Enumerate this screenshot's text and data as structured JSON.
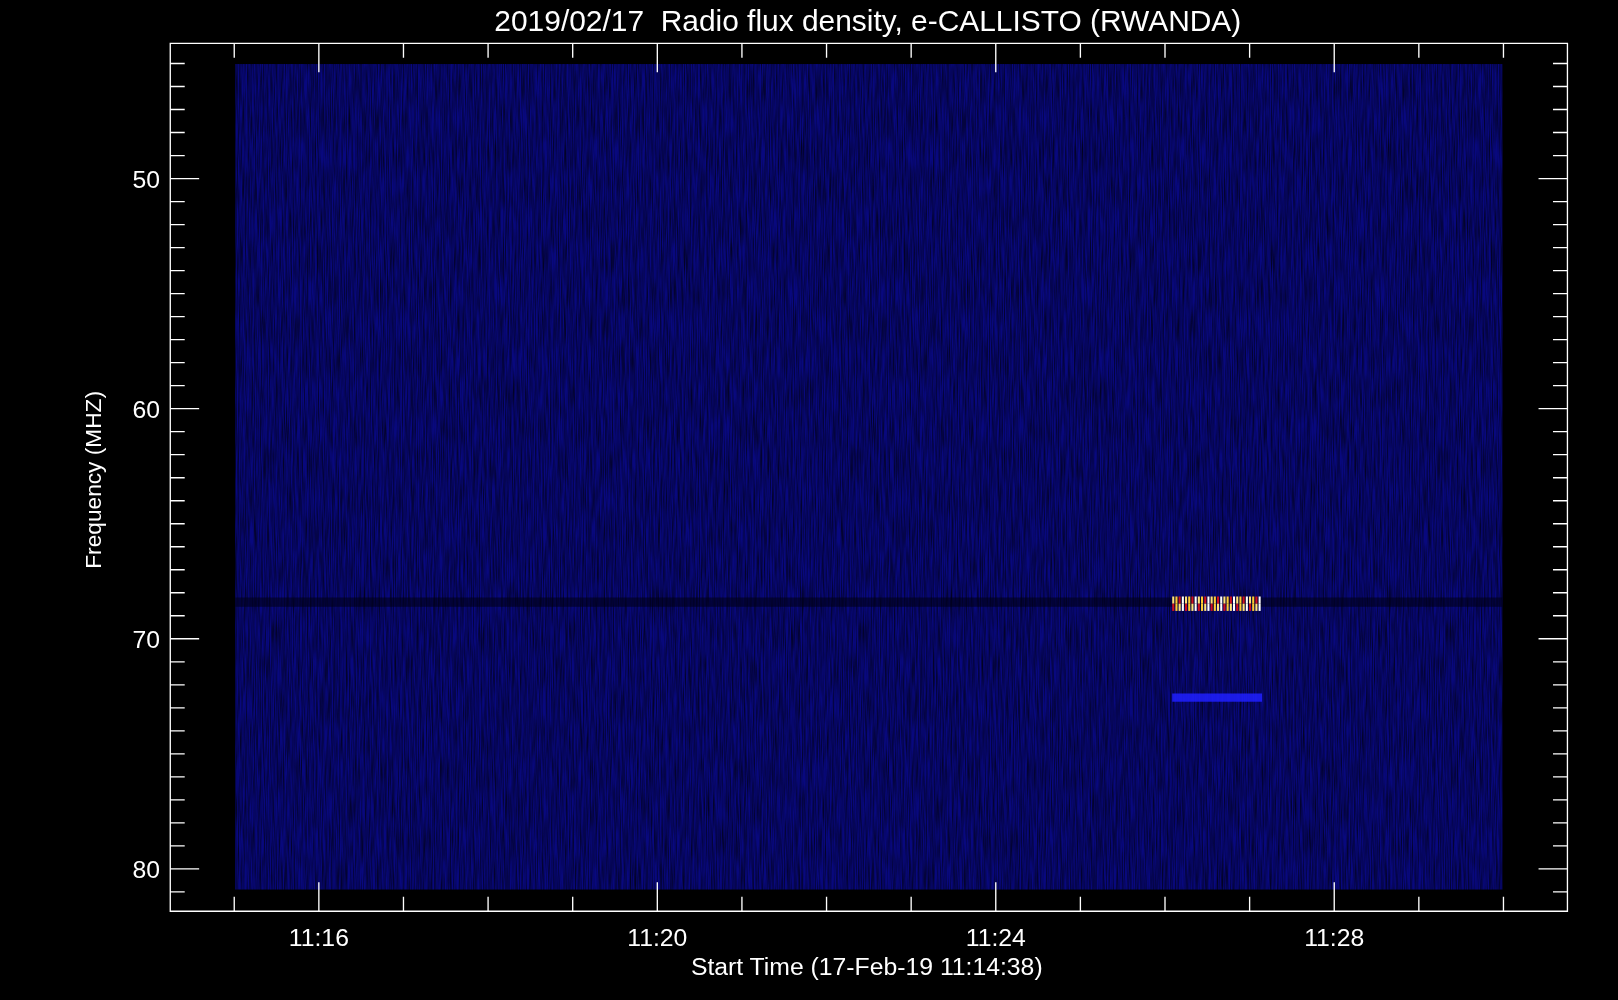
{
  "title": "2019/02/17  Radio flux density, e-CALLISTO (RWANDA)",
  "y_axis": {
    "label": "Frequency (MHZ)",
    "ticks": [
      "50",
      "60",
      "70",
      "80"
    ]
  },
  "x_axis": {
    "label": "Start Time (17-Feb-19 11:14:38)",
    "ticks": [
      "11:16",
      "11:20",
      "11:24",
      "11:28"
    ]
  }
}
